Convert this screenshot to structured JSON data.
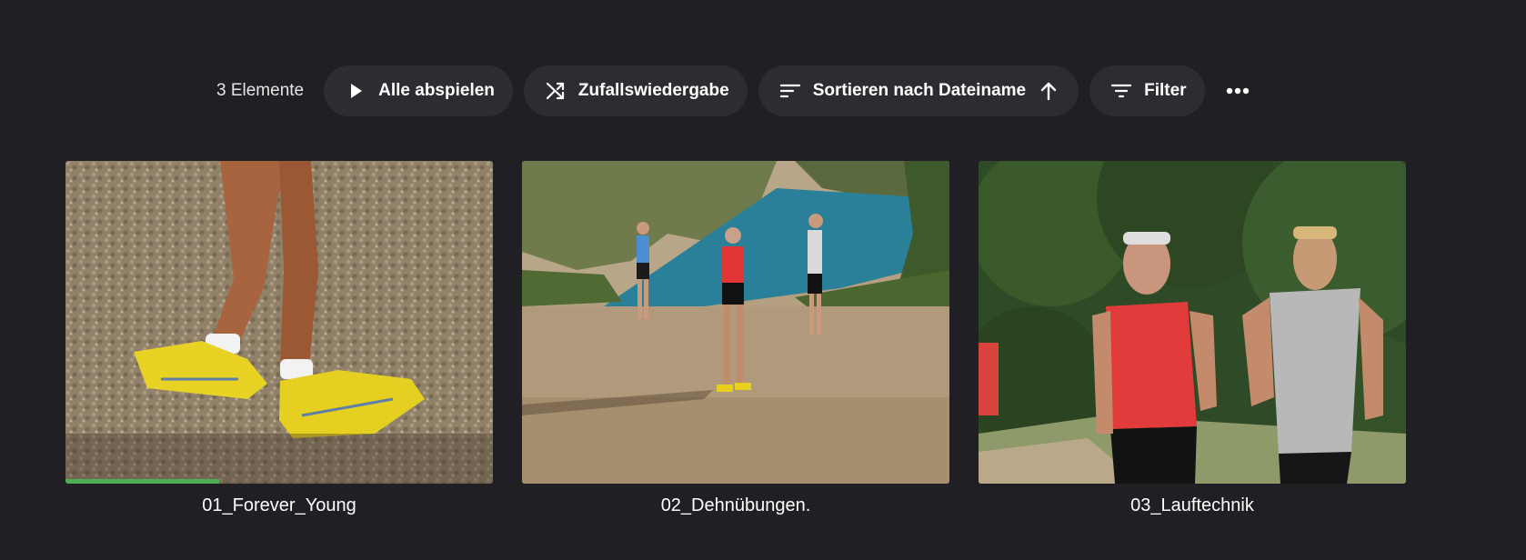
{
  "toolbar": {
    "item_count": "3 Elemente",
    "play_all": "Alle abspielen",
    "shuffle": "Zufallswiedergabe",
    "sort": "Sortieren nach Dateiname",
    "filter": "Filter",
    "icons": {
      "play": "play-icon",
      "shuffle": "shuffle-icon",
      "sort": "sort-icon",
      "sort_direction": "arrow-up-icon",
      "filter": "filter-icon",
      "more": "more-horizontal-icon"
    }
  },
  "videos": [
    {
      "title": "01_Forever_Young",
      "watched_fraction": 0.36
    },
    {
      "title": "02_Dehnübungen."
    },
    {
      "title": "03_Lauftechnik"
    }
  ],
  "colors": {
    "background": "#201f23",
    "pill": "#2d2c30",
    "progress": "#4caf50"
  }
}
